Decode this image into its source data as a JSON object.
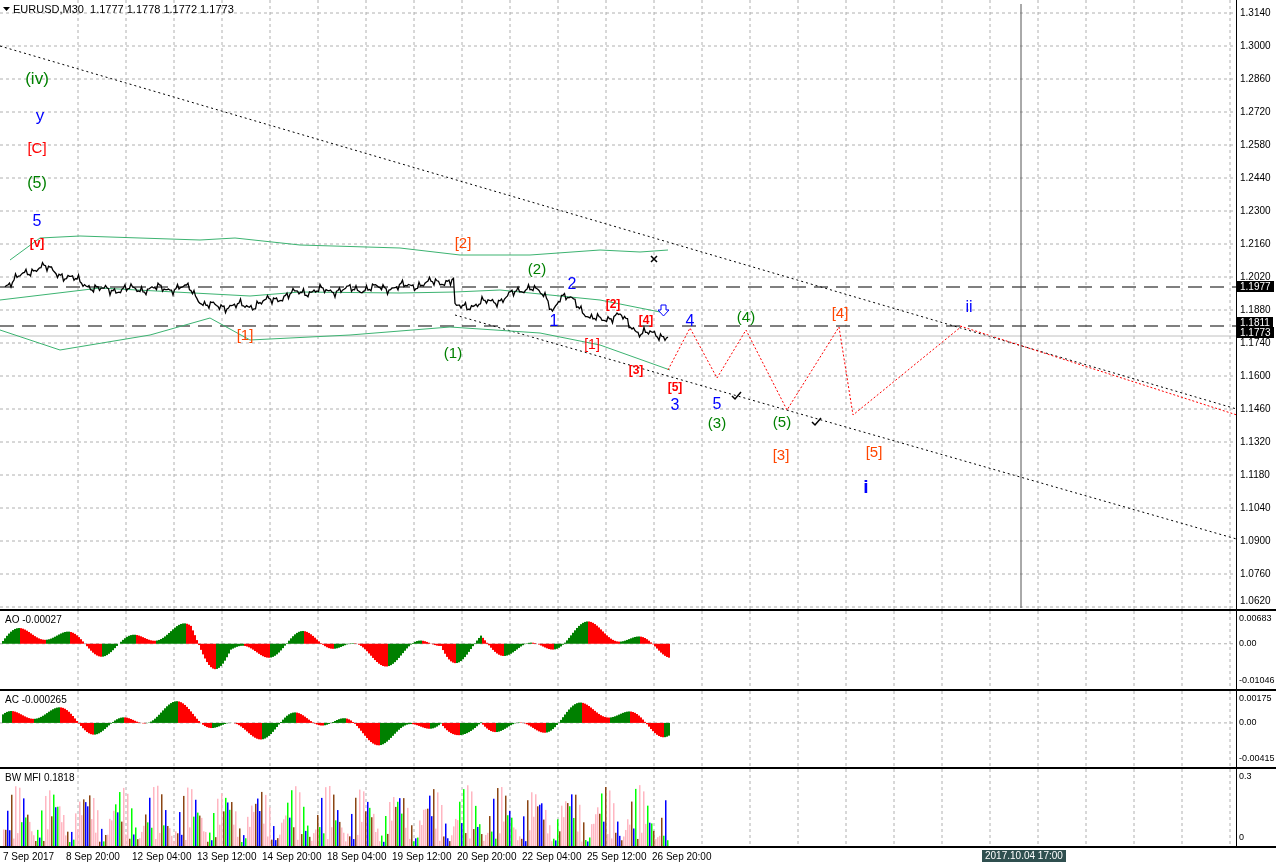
{
  "chart": {
    "title": "EURUSD,M30  1.1777 1.1778 1.1772 1.1773",
    "price_axis": [
      "1.3140",
      "1.3000",
      "1.2860",
      "1.2720",
      "1.2580",
      "1.2440",
      "1.2300",
      "1.2160",
      "1.2020",
      "1.1880",
      "1.1740",
      "1.1600",
      "1.1460",
      "1.1320",
      "1.1180",
      "1.1040",
      "1.0900",
      "1.0760",
      "1.0620"
    ],
    "price_tags": [
      "1.1977",
      "1.1811",
      "1.1773"
    ],
    "wave_labels": [
      {
        "text": "(iv)",
        "color": "#008000"
      },
      {
        "text": "y",
        "color": "#0000ff"
      },
      {
        "text": "[C]",
        "color": "#ff0000"
      },
      {
        "text": "(5)",
        "color": "#008000"
      },
      {
        "text": "5",
        "color": "#0000ff"
      },
      {
        "text": "[v]",
        "color": "#ff0000"
      },
      {
        "text": "[2]",
        "color": "#ff4500"
      },
      {
        "text": "(2)",
        "color": "#008000"
      },
      {
        "text": "2",
        "color": "#0000ff"
      },
      {
        "text": "[2]",
        "color": "#ff0000"
      },
      {
        "text": "1",
        "color": "#0000ff"
      },
      {
        "text": "[4]",
        "color": "#ff0000"
      },
      {
        "text": "4",
        "color": "#0000ff"
      },
      {
        "text": "(4)",
        "color": "#008000"
      },
      {
        "text": "[4]",
        "color": "#ff4500"
      },
      {
        "text": "ii",
        "color": "#0000ff"
      },
      {
        "text": "[1]",
        "color": "#ff4500"
      },
      {
        "text": "(1)",
        "color": "#008000"
      },
      {
        "text": "[1]",
        "color": "#ff0000"
      },
      {
        "text": "[3]",
        "color": "#ff0000"
      },
      {
        "text": "[5]",
        "color": "#ff0000"
      },
      {
        "text": "3",
        "color": "#0000ff"
      },
      {
        "text": "5",
        "color": "#0000ff"
      },
      {
        "text": "(3)",
        "color": "#008000"
      },
      {
        "text": "(5)",
        "color": "#008000"
      },
      {
        "text": "[3]",
        "color": "#ff4500"
      },
      {
        "text": "[5]",
        "color": "#ff4500"
      },
      {
        "text": "i",
        "color": "#0000ff"
      }
    ]
  },
  "indicators": [
    {
      "kind": "oscillator",
      "title": "AO -0.00027",
      "axis": [
        "0.00683",
        "0.00",
        "-0.01046"
      ]
    },
    {
      "kind": "oscillator",
      "title": "AC -0.000265",
      "axis": [
        "0.00175",
        "0.00",
        "-0.00415"
      ]
    },
    {
      "kind": "mfi",
      "title": "BW MFI 0.1818",
      "axis": [
        "0.3",
        "0"
      ]
    }
  ],
  "time_axis": {
    "labels": [
      "7 Sep 2017",
      "8 Sep 20:00",
      "12 Sep 04:00",
      "13 Sep 12:00",
      "14 Sep 20:00",
      "18 Sep 04:00",
      "19 Sep 12:00",
      "20 Sep 20:00",
      "22 Sep 04:00",
      "25 Sep 12:00",
      "26 Sep 20:00"
    ],
    "cursor": "2017.10.04 17:00"
  }
}
